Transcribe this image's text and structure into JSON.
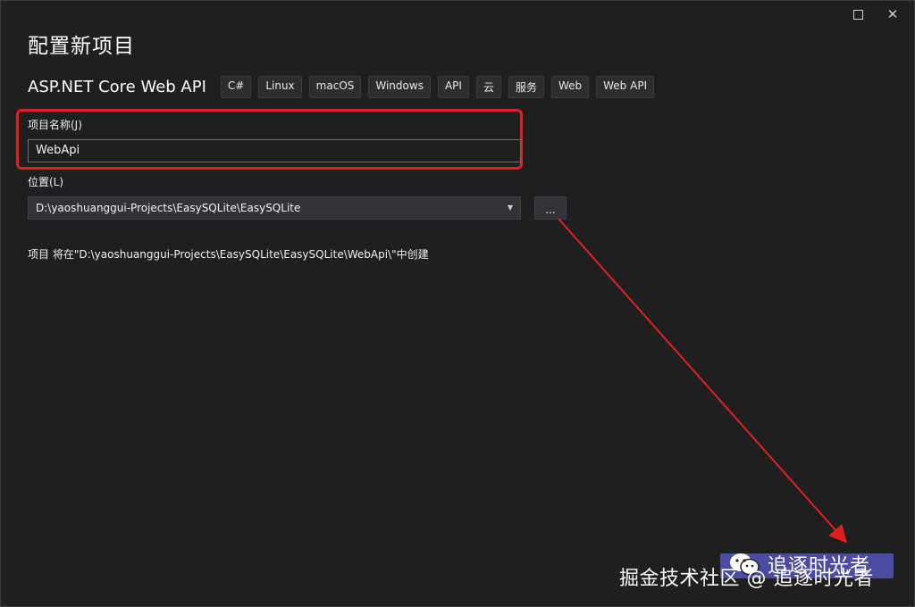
{
  "window": {
    "maximize_icon": "maximize-icon",
    "close_icon": "close-icon"
  },
  "page": {
    "title": "配置新项目",
    "template_name": "ASP.NET Core Web API",
    "tags": [
      "C#",
      "Linux",
      "macOS",
      "Windows",
      "API",
      "云",
      "服务",
      "Web",
      "Web API"
    ]
  },
  "form": {
    "project_name_label": "项目名称(J)",
    "project_name_value": "WebApi",
    "location_label": "位置(L)",
    "location_value": "D:\\yaoshuanggui-Projects\\EasySQLite\\EasySQLite",
    "browse_label": "...",
    "create_note": "项目 将在\"D:\\yaoshuanggui-Projects\\EasySQLite\\EasySQLite\\WebApi\\\"中创建"
  },
  "watermark": {
    "author": "追逐时光者",
    "line": "掘金技术社区 @ 追逐时光者"
  },
  "colors": {
    "background": "#1f1f1f",
    "highlight": "#e02020",
    "accent_button": "#5353b8"
  }
}
